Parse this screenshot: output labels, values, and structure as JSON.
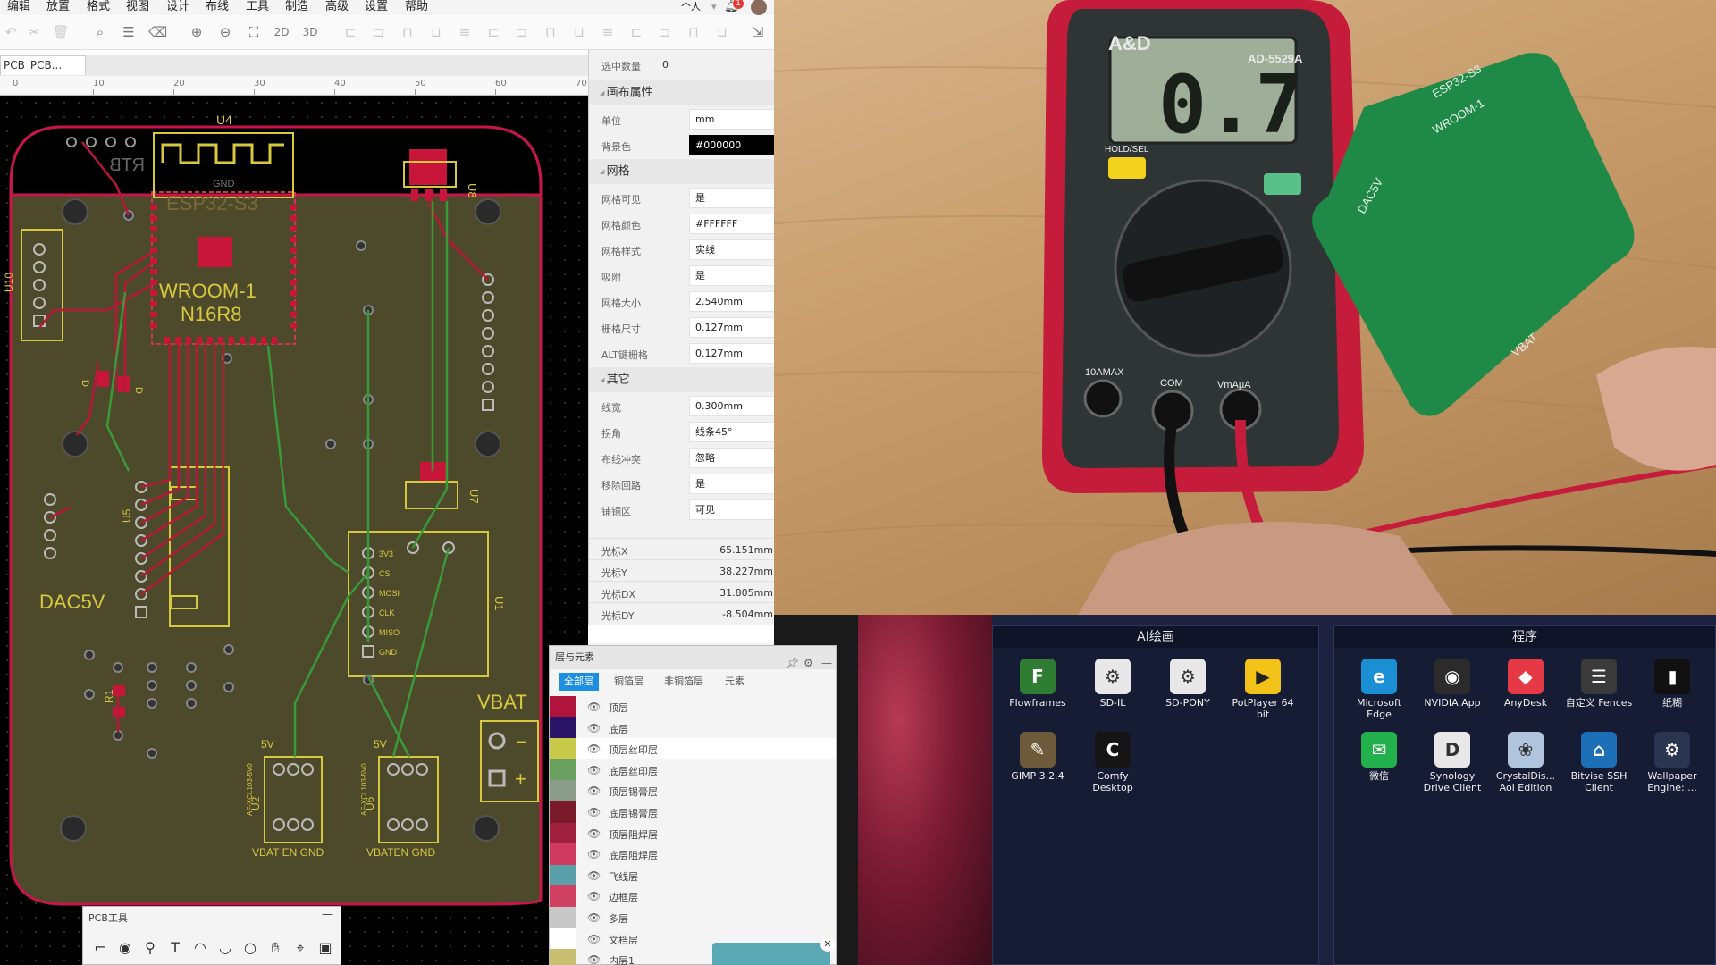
{
  "menu": [
    "编辑",
    "放置",
    "格式",
    "视图",
    "设计",
    "布线",
    "工具",
    "制造",
    "高级",
    "设置",
    "帮助"
  ],
  "user_menu": "个人",
  "notification_count": "1",
  "toolbar": {
    "btn_2d": "2D",
    "btn_3d": "3D"
  },
  "doc_tab": "PCB_PCB...",
  "ruler_labels": [
    "0",
    "10",
    "20",
    "30",
    "40",
    "50",
    "60",
    "70"
  ],
  "pcb": {
    "silk": {
      "u4": "U4",
      "u8": "U8",
      "u10": "U10",
      "u5": "U5",
      "u7": "U7",
      "u1": "U1",
      "u2": "U2",
      "u6": "U6",
      "r1": "R1",
      "d": "D",
      "d1": "D",
      "rtb": "RTB",
      "gnd": "GND",
      "esp": "ESP32-S3",
      "wroom": "WROOM-1",
      "n16r8": "N16R8",
      "dac": "DAC5V",
      "vbat": "VBAT",
      "minus": "−",
      "plus": "+",
      "pin_3v3": "3V3",
      "pin_cs": "CS",
      "pin_mosi": "MOSI",
      "pin_clk": "CLK",
      "pin_miso": "MISO",
      "pin_gnd": "GND",
      "v5_a": "5V",
      "v5_b": "5V",
      "u2_part": "AF-XCL103-5V0",
      "u6_part": "AF-XCL103-5V0",
      "u2_pins": "VBAT EN GND",
      "u6_pins": "VBATEN GND"
    }
  },
  "props": {
    "selected_label": "选中数量",
    "selected_value": "0",
    "sec_canvas": "画布属性",
    "unit_label": "单位",
    "unit_value": "mm",
    "bg_label": "背景色",
    "bg_value": "#000000",
    "sec_grid": "网格",
    "grid_visible_label": "网格可见",
    "grid_visible_value": "是",
    "grid_color_label": "网格颜色",
    "grid_color_value": "#FFFFFF",
    "grid_style_label": "网格样式",
    "grid_style_value": "实线",
    "snap_label": "吸附",
    "snap_value": "是",
    "grid_size_label": "网格大小",
    "grid_size_value": "2.540mm",
    "fence_size_label": "栅格尺寸",
    "fence_size_value": "0.127mm",
    "alt_label": "ALT键栅格",
    "alt_value": "0.127mm",
    "sec_other": "其它",
    "line_w_label": "线宽",
    "line_w_value": "0.300mm",
    "corner_label": "拐角",
    "corner_value": "线条45°",
    "conflict_label": "布线冲突",
    "conflict_value": "忽略",
    "loop_label": "移除回路",
    "loop_value": "是",
    "mask_label": "铺铜区",
    "mask_value": "可见",
    "cursor_x_label": "光标X",
    "cursor_x_value": "65.151mm",
    "cursor_y_label": "光标Y",
    "cursor_y_value": "38.227mm",
    "cursor_dx_label": "光标DX",
    "cursor_dx_value": "31.805mm",
    "cursor_dy_label": "光标DY",
    "cursor_dy_value": "-8.504mm"
  },
  "layers": {
    "title": "层与元素",
    "tabs": [
      "全部层",
      "铜箔层",
      "非铜箔层",
      "元素"
    ],
    "items": [
      {
        "name": "顶层",
        "color": "#b0143c"
      },
      {
        "name": "底层",
        "color": "#2a1466"
      },
      {
        "name": "顶层丝印层",
        "color": "#c9c94a"
      },
      {
        "name": "底层丝印层",
        "color": "#6aa060"
      },
      {
        "name": "顶层锡膏层",
        "color": "#8a9c8a"
      },
      {
        "name": "底层锡膏层",
        "color": "#7a1a2a"
      },
      {
        "name": "顶层阻焊层",
        "color": "#a02040"
      },
      {
        "name": "底层阻焊层",
        "color": "#d03a60"
      },
      {
        "name": "飞线层",
        "color": "#5aa0a8"
      },
      {
        "name": "边框层",
        "color": "#d04060"
      },
      {
        "name": "多层",
        "color": "#c8c8c8"
      },
      {
        "name": "文档层",
        "color": "#ffffff"
      },
      {
        "name": "内层1",
        "color": "#c8c070"
      }
    ]
  },
  "pcb_tools": {
    "title": "PCB工具"
  },
  "camera": {
    "brand": "A&D",
    "model": "AD-5529A",
    "reading": "0.7",
    "hold": "HOLD/SEL",
    "com": "COM",
    "amax": "10AMAX",
    "vma": "VmAμA",
    "board_labels": [
      "ESP32-S3",
      "WROOM-1",
      "DAC5V",
      "VBAT"
    ]
  },
  "desktop": {
    "fence1_title": "AI绘画",
    "fence2_title": "程序",
    "fence1_icons": [
      {
        "label": "Flowframes",
        "glyph": "F",
        "color": "#2e7d32"
      },
      {
        "label": "SD-IL",
        "glyph": "⚙",
        "color": "#e8e8e8"
      },
      {
        "label": "SD-PONY",
        "glyph": "⚙",
        "color": "#e8e8e8"
      },
      {
        "label": "PotPlayer 64 bit",
        "glyph": "▶",
        "color": "#f2c218"
      },
      {
        "label": "GIMP 3.2.4",
        "glyph": "✎",
        "color": "#6d5a3a"
      },
      {
        "label": "Comfy Desktop",
        "glyph": "C",
        "color": "#151515"
      }
    ],
    "fence2_icons": [
      {
        "label": "Microsoft Edge",
        "glyph": "e",
        "color": "#1a8fd4"
      },
      {
        "label": "NVIDIA App",
        "glyph": "◉",
        "color": "#2b2b2b"
      },
      {
        "label": "AnyDesk",
        "glyph": "◆",
        "color": "#e63946"
      },
      {
        "label": "自定义 Fences",
        "glyph": "☰",
        "color": "#3a3a3a"
      },
      {
        "label": "纸糊",
        "glyph": "▮",
        "color": "#111111"
      },
      {
        "label": "微信",
        "glyph": "✉",
        "color": "#22b14c"
      },
      {
        "label": "Synology Drive Client",
        "glyph": "D",
        "color": "#e8e8e8"
      },
      {
        "label": "CrystalDis... Aoi Edition",
        "glyph": "❀",
        "color": "#b0c4de"
      },
      {
        "label": "Bitvise SSH Client",
        "glyph": "⌂",
        "color": "#1d6fb8"
      },
      {
        "label": "Wallpaper Engine: ...",
        "glyph": "⚙",
        "color": "#2a3550"
      }
    ]
  }
}
